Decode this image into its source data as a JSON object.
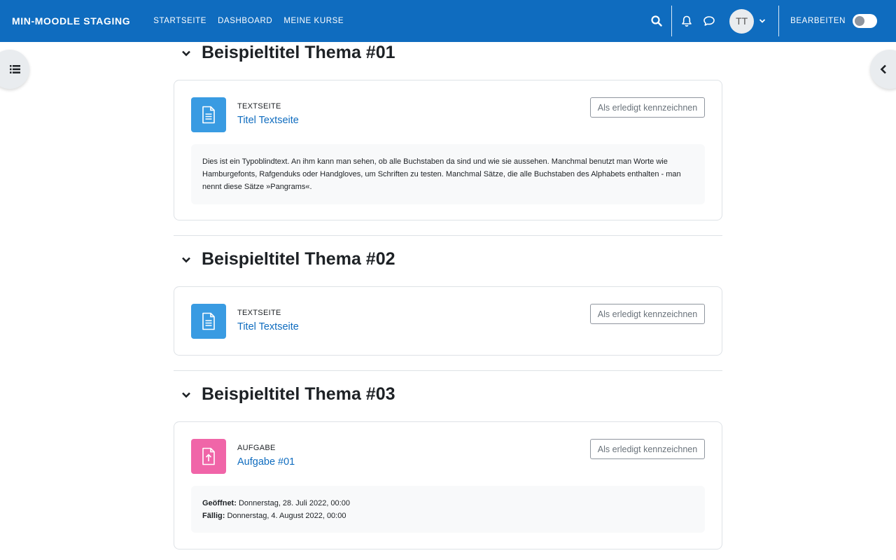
{
  "navbar": {
    "brand": "MIN-MOODLE STAGING",
    "links": [
      "STARTSEITE",
      "DASHBOARD",
      "MEINE KURSE"
    ],
    "avatar_initials": "TT",
    "edit_label": "BEARBEITEN",
    "edit_mode_on": false,
    "color": "#0f6cbf"
  },
  "sections": [
    {
      "title": "Beispieltitel Thema #01",
      "activity": {
        "type": "TEXTSEITE",
        "name": "Titel Textseite",
        "icon": "page-icon",
        "icon_color": "#399be2",
        "done_label": "Als erledigt kennzeichnen",
        "description": "Dies ist ein Typoblindtext. An ihm kann man sehen, ob alle Buchstaben da sind und wie sie aussehen. Manchmal benutzt man Worte wie Hamburgefonts, Rafgenduks oder Handgloves, um Schriften zu testen. Manchmal Sätze, die alle Buchstaben des Alphabets enthalten - man nennt diese Sätze »Pangrams«."
      }
    },
    {
      "title": "Beispieltitel Thema #02",
      "activity": {
        "type": "TEXTSEITE",
        "name": "Titel Textseite",
        "icon": "page-icon",
        "icon_color": "#399be2",
        "done_label": "Als erledigt kennzeichnen"
      }
    },
    {
      "title": "Beispieltitel Thema #03",
      "activity": {
        "type": "AUFGABE",
        "name": "Aufgabe #01",
        "icon": "assignment-upload-icon",
        "icon_color": "#f065a8",
        "done_label": "Als erledigt kennzeichnen",
        "dates": [
          {
            "label": "Geöffnet:",
            "value": "Donnerstag, 28. Juli 2022, 00:00"
          },
          {
            "label": "Fällig:",
            "value": "Donnerstag, 4. August 2022, 00:00"
          }
        ]
      }
    }
  ]
}
